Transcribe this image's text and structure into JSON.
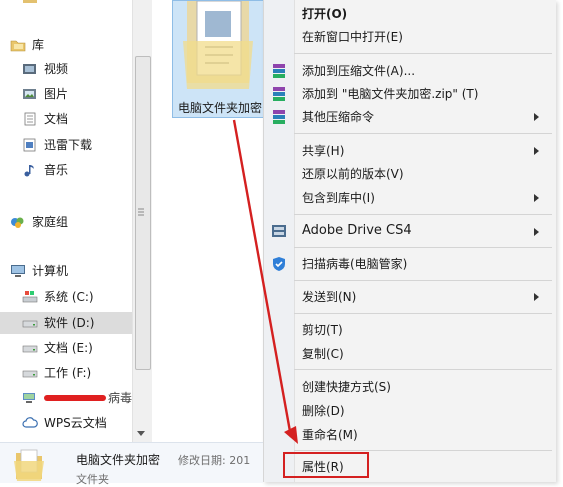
{
  "nav": {
    "library": "库",
    "videos": "视频",
    "pictures": "图片",
    "documents": "文档",
    "xunlei": "迅雷下载",
    "music": "音乐",
    "homegroup": "家庭组",
    "computer": "计算机",
    "drive_c": "系统 (C:)",
    "drive_d": "软件 (D:)",
    "drive_e": "文档 (E:)",
    "drive_f": "工作 (F:)",
    "redacted_suffix": "病毒",
    "wps": "WPS云文档"
  },
  "file": {
    "name": "电脑文件夹加密"
  },
  "menu": {
    "open": "打开(O)",
    "open_new_window": "在新窗口中打开(E)",
    "add_archive": "添加到压缩文件(A)...",
    "add_zip": "添加到 \"电脑文件夹加密.zip\" (T)",
    "other_compress": "其他压缩命令",
    "share": "共享(H)",
    "restore": "还原以前的版本(V)",
    "include_library": "包含到库中(I)",
    "adobe": "Adobe Drive CS4",
    "scan": "扫描病毒(电脑管家)",
    "send_to": "发送到(N)",
    "cut": "剪切(T)",
    "copy": "复制(C)",
    "shortcut": "创建快捷方式(S)",
    "delete": "删除(D)",
    "rename": "重命名(M)",
    "properties": "属性(R)"
  },
  "details": {
    "name": "电脑文件夹加密",
    "modified_label": "修改日期: 201",
    "type": "文件夹"
  },
  "colors": {
    "highlight": "#d42020",
    "arrow": "#d42020",
    "selection": "#cde4f7"
  }
}
